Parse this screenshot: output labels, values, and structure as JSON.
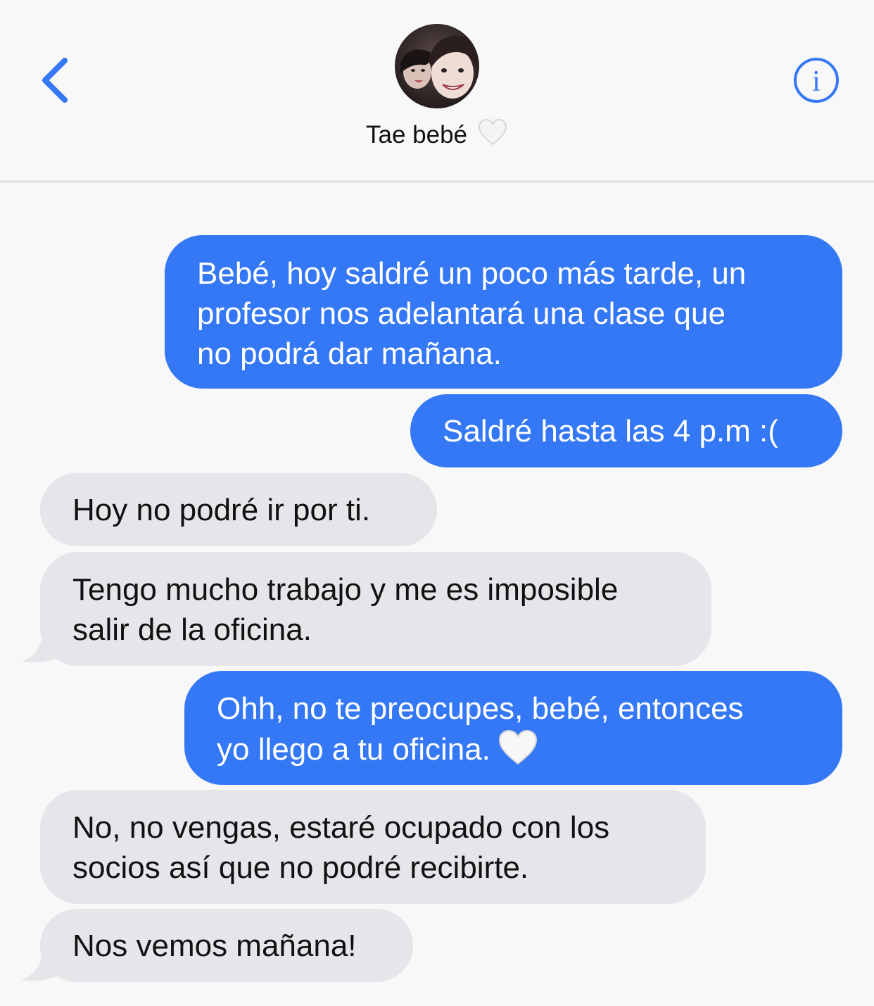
{
  "header": {
    "contact_name": "Tae bebé",
    "back_icon": "chevron-left-icon",
    "info_icon": "info-icon",
    "accent_color": "#3478f6"
  },
  "messages": [
    {
      "direction": "sent",
      "lines": [
        "Bebé, hoy saldré un poco más tarde, un",
        "profesor nos adelantará una clase que",
        "no podrá dar mañana."
      ]
    },
    {
      "direction": "sent",
      "lines": [
        "Saldré hasta las 4 p.m :("
      ]
    },
    {
      "direction": "received",
      "lines": [
        "Hoy no podré ir por ti."
      ]
    },
    {
      "direction": "received",
      "lines": [
        "Tengo mucho trabajo y me es imposible",
        "salir de la oficina."
      ]
    },
    {
      "direction": "sent",
      "lines": [
        "Ohh, no te preocupes, bebé, entonces",
        "yo llego a tu oficina."
      ],
      "trailing_emoji": "white-heart"
    },
    {
      "direction": "received",
      "lines": [
        "No, no vengas, estaré ocupado con los",
        "socios así que no podré recibirte."
      ]
    },
    {
      "direction": "received",
      "lines": [
        "Nos vemos mañana!"
      ]
    }
  ],
  "colors": {
    "sent_bubble": "#3478f6",
    "received_bubble": "#e5e5ea",
    "background": "#f8f8f8"
  }
}
